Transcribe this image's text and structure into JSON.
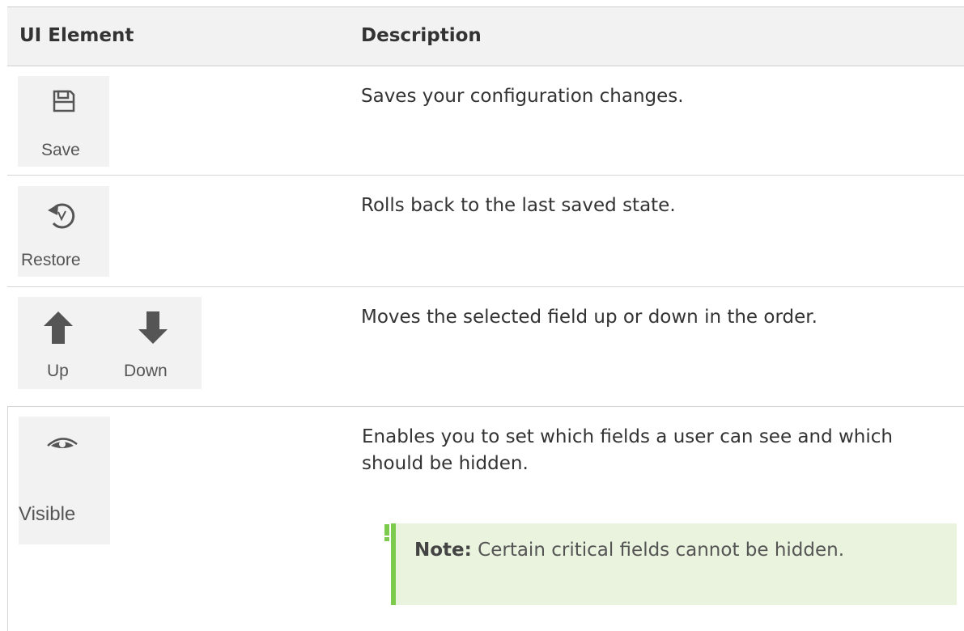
{
  "header": {
    "col_ui": "UI Element",
    "col_desc": "Description"
  },
  "rows": [
    {
      "icon": "save-icon",
      "labels": [
        "Save"
      ],
      "description": "Saves your configuration changes."
    },
    {
      "icon": "restore-icon",
      "labels": [
        "Restore"
      ],
      "description": "Rolls back to the last saved state."
    },
    {
      "icon": "up-down-arrows-icon",
      "labels": [
        "Up",
        "Down"
      ],
      "description": "Moves the selected field up or down in the order."
    },
    {
      "icon": "eye-icon",
      "labels": [
        "Visible"
      ],
      "description": "Enables you to set which fields a user can see and which should be hidden."
    }
  ],
  "note": {
    "label": "Note:",
    "text": "Certain critical fields cannot be hidden."
  },
  "colors": {
    "note_bg": "#eaf3de",
    "note_border": "#7ccb4c",
    "header_bg": "#f2f2f2"
  }
}
